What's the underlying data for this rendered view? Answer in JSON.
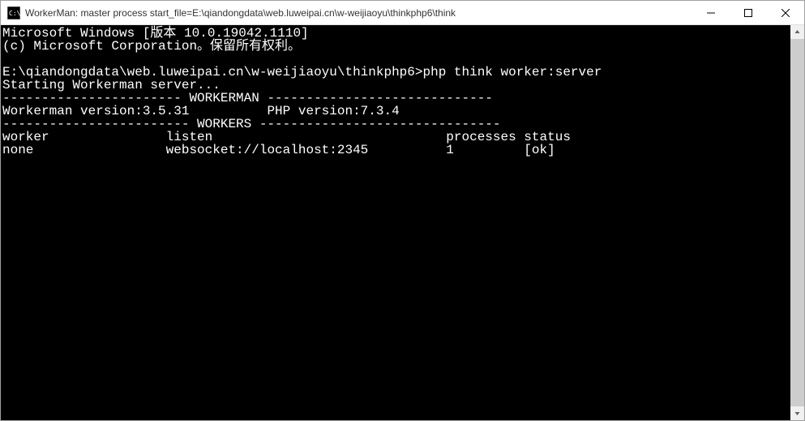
{
  "window": {
    "title": "WorkerMan: master process  start_file=E:\\qiandongdata\\web.luweipai.cn\\w-weijiaoyu\\thinkphp6\\think"
  },
  "terminal": {
    "lines": [
      "Microsoft Windows [版本 10.0.19042.1110]",
      "(c) Microsoft Corporation。保留所有权利。",
      "",
      "E:\\qiandongdata\\web.luweipai.cn\\w-weijiaoyu\\thinkphp6>php think worker:server",
      "Starting Workerman server...",
      "----------------------- WORKERMAN -----------------------------",
      "Workerman version:3.5.31          PHP version:7.3.4",
      "------------------------ WORKERS -------------------------------",
      "worker               listen                              processes status",
      "none                 websocket://localhost:2345          1         [ok]"
    ]
  },
  "system": {
    "os_name": "Microsoft Windows",
    "os_version": "10.0.19042.1110",
    "copyright": "(c) Microsoft Corporation。保留所有权利。"
  },
  "workerman": {
    "workerman_version": "3.5.31",
    "php_version": "7.3.4",
    "path": "E:\\qiandongdata\\web.luweipai.cn\\w-weijiaoyu\\thinkphp6",
    "command": "php think worker:server",
    "starting_message": "Starting Workerman server...",
    "workers": [
      {
        "worker": "none",
        "listen": "websocket://localhost:2345",
        "processes": "1",
        "status": "[ok]"
      }
    ]
  }
}
